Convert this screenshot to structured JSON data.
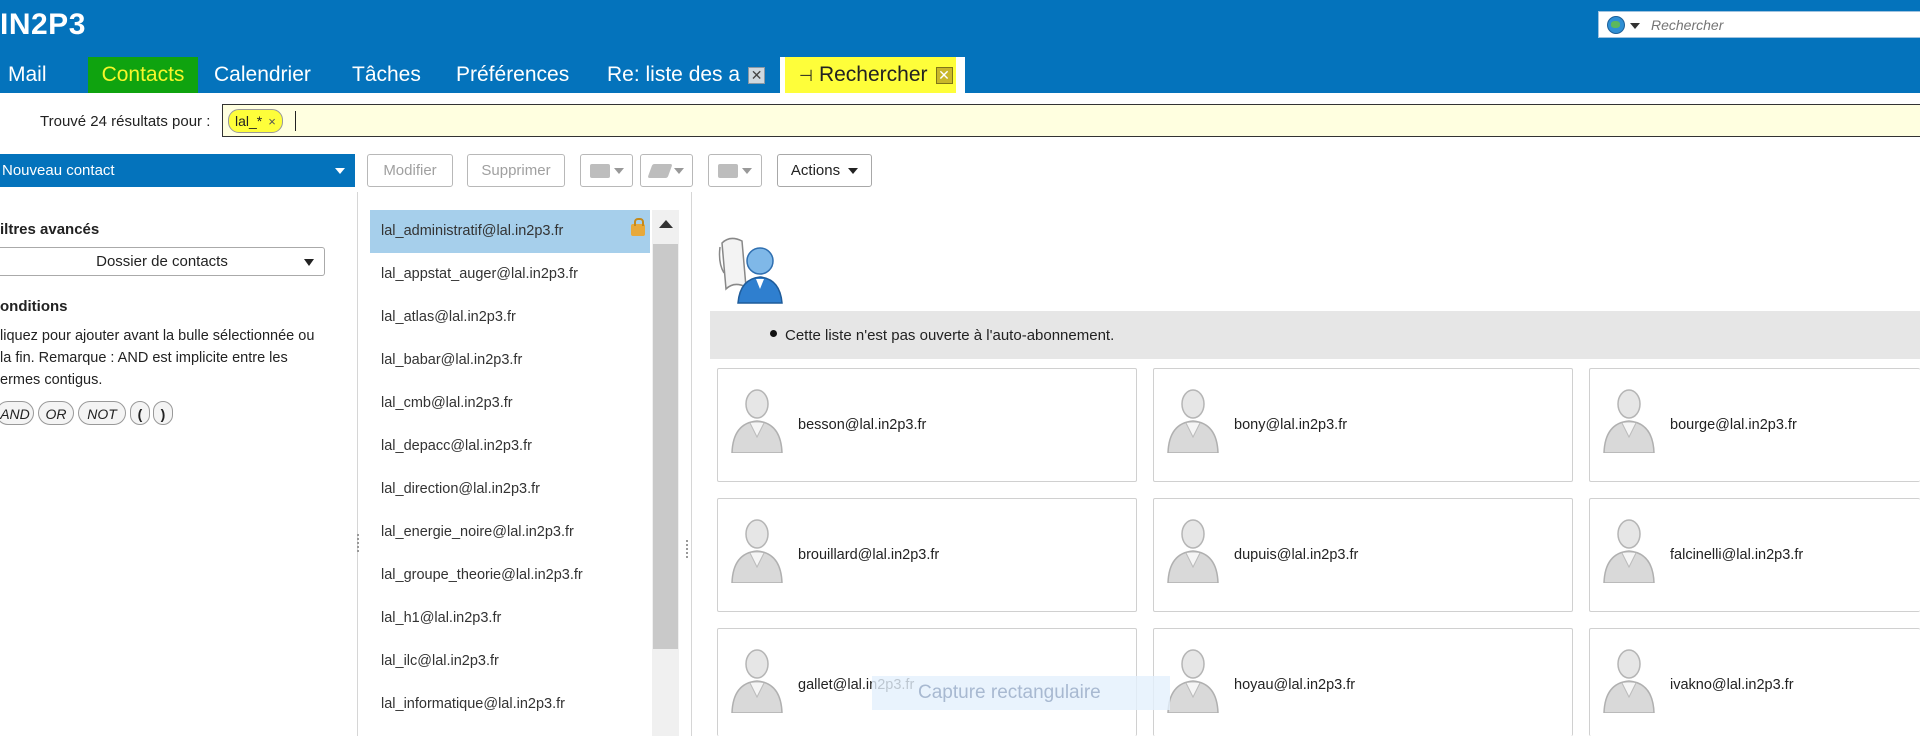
{
  "app": {
    "logo": "IN2P3",
    "search_placeholder": "Rechercher"
  },
  "tabs": [
    {
      "label": "Mail"
    },
    {
      "label": "Contacts"
    },
    {
      "label": "Calendrier"
    },
    {
      "label": "Tâches"
    },
    {
      "label": "Préférences"
    },
    {
      "label": "Re: liste des a"
    },
    {
      "label": "Rechercher"
    }
  ],
  "search": {
    "result_label": "Trouvé 24 résultats pour :",
    "query": "lal_*",
    "remove_symbol": "×"
  },
  "toolbar": {
    "new_contact": "Nouveau contact",
    "modify": "Modifier",
    "delete": "Supprimer",
    "actions": "Actions"
  },
  "filters": {
    "title": "iltres avancés",
    "folder_select": "Dossier de contacts",
    "conditions_title": "onditions",
    "conditions_help": [
      "liquez pour ajouter avant la bulle sélectionnée ou",
      " la fin. Remarque : AND est implicite entre les",
      "ermes contigus."
    ],
    "operators": [
      "AND",
      "OR",
      "NOT",
      "(",
      ")"
    ]
  },
  "lists": [
    "lal_administratif@lal.in2p3.fr",
    "lal_appstat_auger@lal.in2p3.fr",
    "lal_atlas@lal.in2p3.fr",
    "lal_babar@lal.in2p3.fr",
    "lal_cmb@lal.in2p3.fr",
    "lal_depacc@lal.in2p3.fr",
    "lal_direction@lal.in2p3.fr",
    "lal_energie_noire@lal.in2p3.fr",
    "lal_groupe_theorie@lal.in2p3.fr",
    "lal_h1@lal.in2p3.fr",
    "lal_ilc@lal.in2p3.fr",
    "lal_informatique@lal.in2p3.fr"
  ],
  "detail": {
    "notice": "Cette liste n'est pas ouverte à l'auto-abonnement.",
    "members": [
      "besson@lal.in2p3.fr",
      "bony@lal.in2p3.fr",
      "bourge@lal.in2p3.fr",
      "brouillard@lal.in2p3.fr",
      "dupuis@lal.in2p3.fr",
      "falcinelli@lal.in2p3.fr",
      "gallet@lal.in2p3.fr",
      "hoyau@lal.in2p3.fr",
      "ivakno@lal.in2p3.fr"
    ]
  },
  "overlay": {
    "label": "Capture rectangulaire"
  },
  "colors": {
    "header_blue": "#0473bc",
    "highlight_yellow": "#fefe3a",
    "highlight_green": "#0fa30f",
    "selected_row": "#a6cfeb",
    "query_bg": "#ffffe0"
  }
}
